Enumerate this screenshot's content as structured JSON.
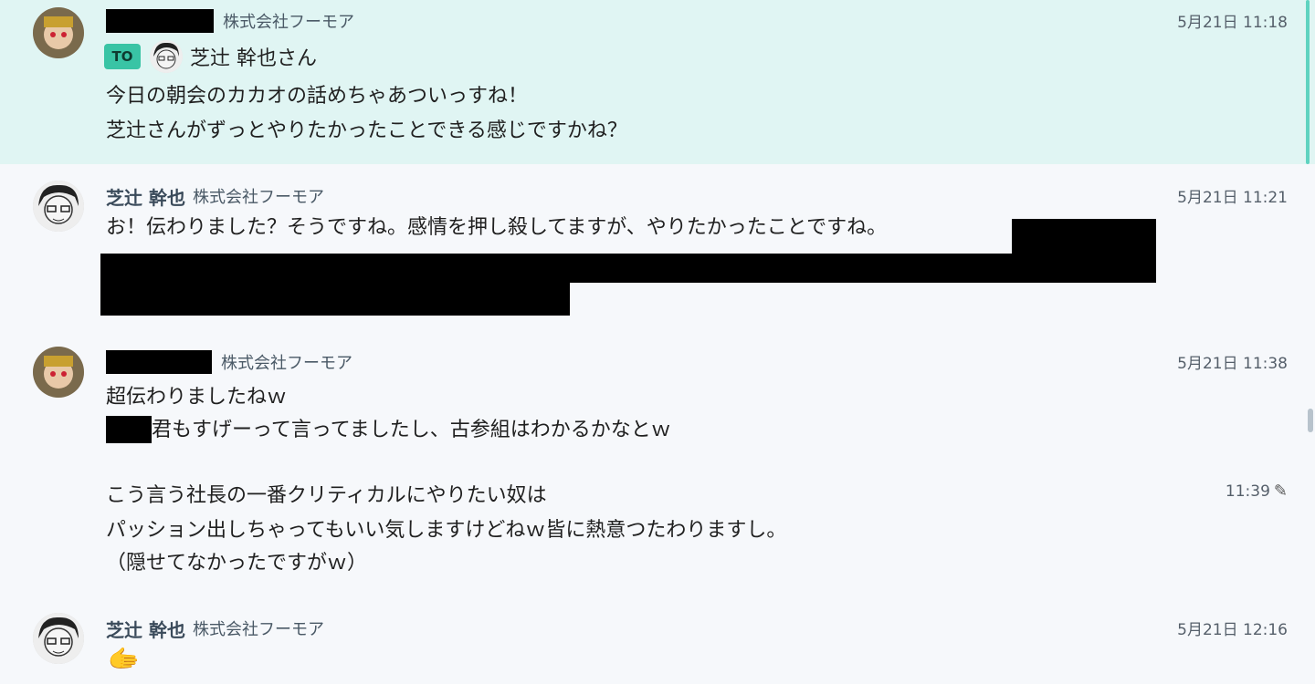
{
  "company": "株式会社フーモア",
  "messages": [
    {
      "time": "5月21日 11:18",
      "to_label": "TO",
      "to_name": "芝辻 幹也さん",
      "lines": [
        "今日の朝会のカカオの話めちゃあついっすね！",
        "芝辻さんがずっとやりたかったことできる感じですかね？"
      ]
    },
    {
      "sender": "芝辻 幹也",
      "time": "5月21日 11:21",
      "lines": [
        "お！伝わりました？そうですね。感情を押し殺してますが、やりたかったことですね。"
      ]
    },
    {
      "time": "5月21日 11:38",
      "lines": [
        "超伝わりましたねｗ",
        "君もすげーって言ってましたし、古参組はわかるかなとｗ"
      ],
      "edited_time": "11:39",
      "lines2": [
        "こう言う社長の一番クリティカルにやりたい奴は",
        "パッション出しちゃってもいい気しますけどねｗ皆に熱意つたわりますし。",
        "（隠せてなかったですがｗ）"
      ]
    },
    {
      "sender": "芝辻 幹也",
      "time": "5月21日 12:16",
      "emoji": "🫱"
    }
  ],
  "icons": {
    "edit": "pencil-icon"
  },
  "colors": {
    "highlight_bg": "#e0f5f3",
    "accent": "#39c4a5"
  }
}
